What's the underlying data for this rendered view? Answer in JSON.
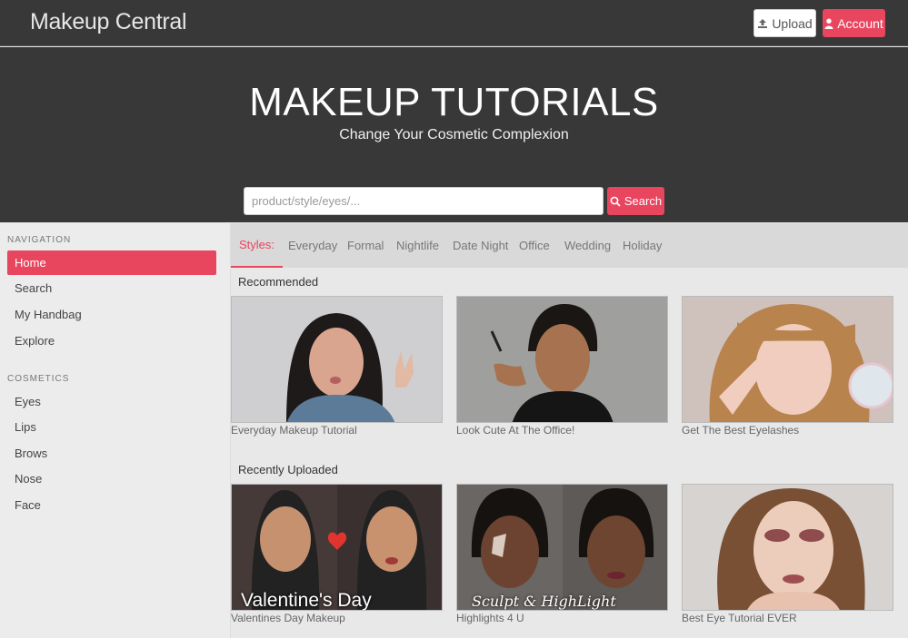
{
  "header": {
    "brand": "Makeup Central",
    "upload_label": "Upload",
    "account_label": "Account"
  },
  "hero": {
    "title": "MAKEUP TUTORIALS",
    "subtitle": "Change Your Cosmetic Complexion",
    "search_placeholder": "product/style/eyes/...",
    "search_value": "",
    "search_label": "Search"
  },
  "sidebar": {
    "navigation_heading": "NAVIGATION",
    "navigation": [
      {
        "label": "Home",
        "active": true
      },
      {
        "label": "Search"
      },
      {
        "label": "My Handbag"
      },
      {
        "label": "Explore"
      }
    ],
    "cosmetics_heading": "COSMETICS",
    "cosmetics": [
      {
        "label": "Eyes"
      },
      {
        "label": "Lips"
      },
      {
        "label": "Brows"
      },
      {
        "label": "Nose"
      },
      {
        "label": "Face"
      }
    ]
  },
  "styles": {
    "tabs": [
      "Styles:",
      "Everyday",
      "Formal",
      "Nightlife",
      "Date Night",
      "Office",
      "Wedding",
      "Holiday"
    ]
  },
  "recommended": {
    "title": "Recommended",
    "videos": [
      {
        "title": "Everyday Makeup Tutorial"
      },
      {
        "title": "Look Cute At The Office!"
      },
      {
        "title": "Get The Best Eyelashes"
      }
    ]
  },
  "recent": {
    "title": "Recently Uploaded",
    "videos": [
      {
        "title": "Valentines Day Makeup",
        "overlay": "Valentine's Day Makeup"
      },
      {
        "title": "Highlights 4 U",
        "overlay": "Sculpt & HighLight"
      },
      {
        "title": "Best Eye Tutorial EVER"
      }
    ]
  },
  "colors": {
    "accent": "#e8455f",
    "header_bg": "#383838"
  },
  "icons": {
    "upload": "upload-icon",
    "account": "user-icon",
    "search": "search-icon"
  }
}
